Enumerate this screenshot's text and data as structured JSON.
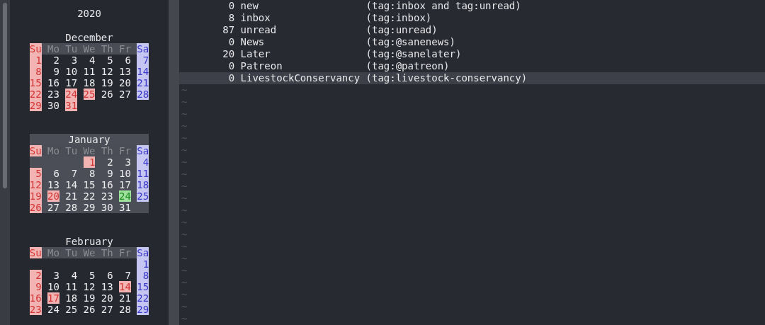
{
  "calendar": {
    "year": "2020",
    "months": [
      {
        "name": "December",
        "selected": false,
        "weekdays": [
          "Su",
          "Mo",
          "Tu",
          "We",
          "Th",
          "Fr",
          "Sa"
        ],
        "weeks": [
          [
            {
              "day": "1",
              "kind": "day"
            },
            {
              "day": "2",
              "kind": "day"
            },
            {
              "day": "3",
              "kind": "day"
            },
            {
              "day": "4",
              "kind": "day"
            },
            {
              "day": "5",
              "kind": "day"
            },
            {
              "day": "6",
              "kind": "day"
            },
            {
              "day": "7",
              "kind": "day"
            }
          ],
          [
            {
              "day": "8",
              "kind": "day"
            },
            {
              "day": "9",
              "kind": "day"
            },
            {
              "day": "10",
              "kind": "day"
            },
            {
              "day": "11",
              "kind": "day"
            },
            {
              "day": "12",
              "kind": "day"
            },
            {
              "day": "13",
              "kind": "day"
            },
            {
              "day": "14",
              "kind": "day"
            }
          ],
          [
            {
              "day": "15",
              "kind": "day"
            },
            {
              "day": "16",
              "kind": "day"
            },
            {
              "day": "17",
              "kind": "day"
            },
            {
              "day": "18",
              "kind": "day"
            },
            {
              "day": "19",
              "kind": "day"
            },
            {
              "day": "20",
              "kind": "day"
            },
            {
              "day": "21",
              "kind": "day"
            }
          ],
          [
            {
              "day": "22",
              "kind": "day"
            },
            {
              "day": "23",
              "kind": "day"
            },
            {
              "day": "24",
              "kind": "holiday"
            },
            {
              "day": "25",
              "kind": "holiday"
            },
            {
              "day": "26",
              "kind": "day"
            },
            {
              "day": "27",
              "kind": "day"
            },
            {
              "day": "28",
              "kind": "day"
            }
          ],
          [
            {
              "day": "29",
              "kind": "day"
            },
            {
              "day": "30",
              "kind": "day"
            },
            {
              "day": "31",
              "kind": "holiday"
            },
            {
              "kind": "blank"
            },
            {
              "kind": "blank"
            },
            {
              "kind": "blank"
            },
            {
              "kind": "blank"
            }
          ]
        ]
      },
      {
        "name": "January",
        "selected": true,
        "weekdays": [
          "Su",
          "Mo",
          "Tu",
          "We",
          "Th",
          "Fr",
          "Sa"
        ],
        "weeks": [
          [
            {
              "kind": "blank"
            },
            {
              "kind": "blank"
            },
            {
              "kind": "blank"
            },
            {
              "day": "1",
              "kind": "holiday"
            },
            {
              "day": "2",
              "kind": "day"
            },
            {
              "day": "3",
              "kind": "day"
            },
            {
              "day": "4",
              "kind": "day"
            }
          ],
          [
            {
              "day": "5",
              "kind": "day"
            },
            {
              "day": "6",
              "kind": "day"
            },
            {
              "day": "7",
              "kind": "day"
            },
            {
              "day": "8",
              "kind": "day"
            },
            {
              "day": "9",
              "kind": "day"
            },
            {
              "day": "10",
              "kind": "day"
            },
            {
              "day": "11",
              "kind": "day"
            }
          ],
          [
            {
              "day": "12",
              "kind": "day"
            },
            {
              "day": "13",
              "kind": "day"
            },
            {
              "day": "14",
              "kind": "day"
            },
            {
              "day": "15",
              "kind": "day"
            },
            {
              "day": "16",
              "kind": "day"
            },
            {
              "day": "17",
              "kind": "day"
            },
            {
              "day": "18",
              "kind": "day"
            }
          ],
          [
            {
              "day": "19",
              "kind": "day"
            },
            {
              "day": "20",
              "kind": "holiday"
            },
            {
              "day": "21",
              "kind": "day"
            },
            {
              "day": "22",
              "kind": "day"
            },
            {
              "day": "23",
              "kind": "day"
            },
            {
              "day": "24",
              "kind": "today"
            },
            {
              "day": "25",
              "kind": "day"
            }
          ],
          [
            {
              "day": "26",
              "kind": "day"
            },
            {
              "day": "27",
              "kind": "day"
            },
            {
              "day": "28",
              "kind": "day"
            },
            {
              "day": "29",
              "kind": "day"
            },
            {
              "day": "30",
              "kind": "day"
            },
            {
              "day": "31",
              "kind": "day"
            },
            {
              "kind": "blank"
            }
          ]
        ]
      },
      {
        "name": "February",
        "selected": false,
        "weekdays": [
          "Su",
          "Mo",
          "Tu",
          "We",
          "Th",
          "Fr",
          "Sa"
        ],
        "weeks": [
          [
            {
              "kind": "blank"
            },
            {
              "kind": "blank"
            },
            {
              "kind": "blank"
            },
            {
              "kind": "blank"
            },
            {
              "kind": "blank"
            },
            {
              "kind": "blank"
            },
            {
              "day": "1",
              "kind": "day"
            }
          ],
          [
            {
              "day": "2",
              "kind": "day"
            },
            {
              "day": "3",
              "kind": "day"
            },
            {
              "day": "4",
              "kind": "day"
            },
            {
              "day": "5",
              "kind": "day"
            },
            {
              "day": "6",
              "kind": "day"
            },
            {
              "day": "7",
              "kind": "day"
            },
            {
              "day": "8",
              "kind": "day"
            }
          ],
          [
            {
              "day": "9",
              "kind": "day"
            },
            {
              "day": "10",
              "kind": "day"
            },
            {
              "day": "11",
              "kind": "day"
            },
            {
              "day": "12",
              "kind": "day"
            },
            {
              "day": "13",
              "kind": "day"
            },
            {
              "day": "14",
              "kind": "holiday"
            },
            {
              "day": "15",
              "kind": "day"
            }
          ],
          [
            {
              "day": "16",
              "kind": "day"
            },
            {
              "day": "17",
              "kind": "holiday"
            },
            {
              "day": "18",
              "kind": "day"
            },
            {
              "day": "19",
              "kind": "day"
            },
            {
              "day": "20",
              "kind": "day"
            },
            {
              "day": "21",
              "kind": "day"
            },
            {
              "day": "22",
              "kind": "day"
            }
          ],
          [
            {
              "day": "23",
              "kind": "day"
            },
            {
              "day": "24",
              "kind": "day"
            },
            {
              "day": "25",
              "kind": "day"
            },
            {
              "day": "26",
              "kind": "day"
            },
            {
              "day": "27",
              "kind": "day"
            },
            {
              "day": "28",
              "kind": "day"
            },
            {
              "day": "29",
              "kind": "day"
            }
          ]
        ]
      }
    ]
  },
  "searches": [
    {
      "count": "0",
      "name": "new",
      "query": "(tag:inbox and tag:unread)",
      "selected": false
    },
    {
      "count": "8",
      "name": "inbox",
      "query": "(tag:inbox)",
      "selected": false
    },
    {
      "count": "87",
      "name": "unread",
      "query": "(tag:unread)",
      "selected": false
    },
    {
      "count": "0",
      "name": "News",
      "query": "(tag:@sanenews)",
      "selected": false
    },
    {
      "count": "20",
      "name": "Later",
      "query": "(tag:@sanelater)",
      "selected": false
    },
    {
      "count": "0",
      "name": "Patreon",
      "query": "(tag:@patreon)",
      "selected": false
    },
    {
      "count": "0",
      "name": "LivestockConservancy",
      "query": "(tag:livestock-conservancy)",
      "selected": true
    }
  ],
  "empty_line_markers": [
    "~",
    "~",
    "~",
    "~",
    "~",
    "~",
    "~",
    "~",
    "~",
    "~",
    "~",
    "~",
    "~",
    "~",
    "~",
    "~",
    "~",
    "~",
    "~",
    "~"
  ]
}
